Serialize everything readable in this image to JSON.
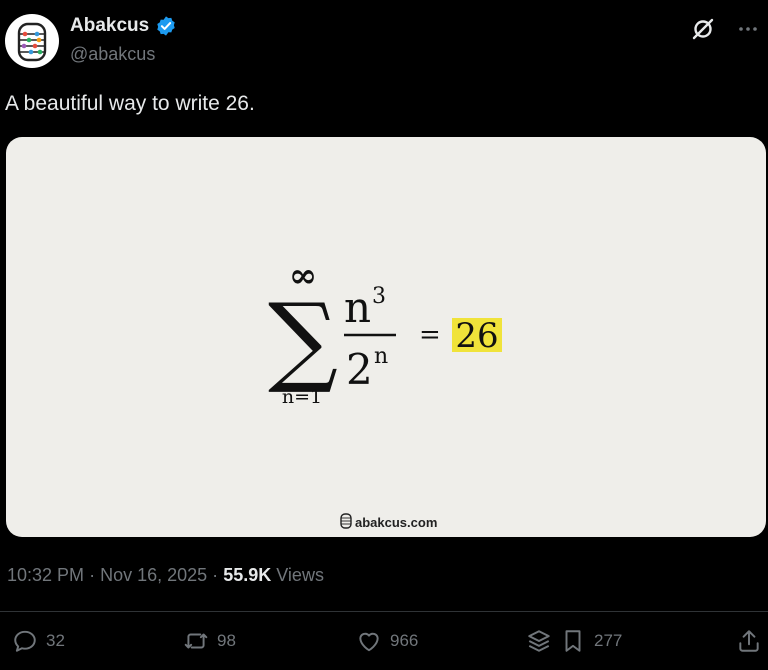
{
  "author": {
    "name": "Abakcus",
    "handle": "@abakcus"
  },
  "tweet": {
    "text": "A beautiful way to write 26."
  },
  "card": {
    "sum_upper": "∞",
    "sum_symbol": "∑",
    "sum_lower": "n=1",
    "numerator_base": "n",
    "numerator_exp": "3",
    "denominator_base": "2",
    "denominator_exp": "n",
    "equals": "=",
    "result": "26",
    "watermark": "abakcus.com",
    "highlight_color": "#f0e33a",
    "background_color": "#efeeea"
  },
  "meta": {
    "time": "10:32 PM",
    "sep1": "·",
    "date": "Nov 16, 2025",
    "sep2": "·",
    "views_count": "55.9K",
    "views_label": "Views"
  },
  "actions": {
    "replies": "32",
    "reposts": "98",
    "likes": "966",
    "bookmarks": "277"
  },
  "colors": {
    "background": "#000000",
    "text": "#e7e9ea",
    "muted": "#71767b",
    "verified": "#1d9bf0"
  }
}
